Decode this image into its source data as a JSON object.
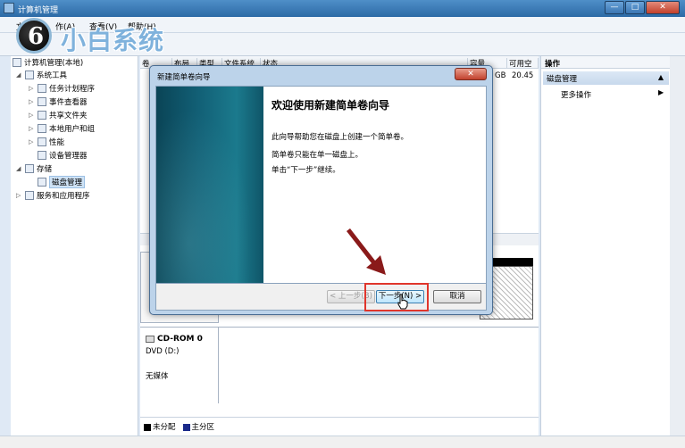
{
  "window": {
    "title": "计算机管理",
    "minimize": "—",
    "maximize": "□",
    "close": "✕"
  },
  "menu": [
    "文",
    "作(A)",
    "查看(V)",
    "帮助(H)"
  ],
  "logo": {
    "badge": "6",
    "text": "小白系统"
  },
  "tree": {
    "root": "计算机管理(本地)",
    "system_tools": "系统工具",
    "task_scheduler": "任务计划程序",
    "event_viewer": "事件查看器",
    "shared_folders": "共享文件夹",
    "local_users": "本地用户和组",
    "performance": "性能",
    "device_manager": "设备管理器",
    "storage": "存储",
    "disk_management": "磁盘管理",
    "services_apps": "服务和应用程序"
  },
  "list": {
    "columns": [
      "卷",
      "布局",
      "类型",
      "文件系统",
      "状态",
      "容量",
      "可用空"
    ],
    "row1": {
      "capacity": "GB",
      "free": "20.45"
    }
  },
  "disks": {
    "cdrom_label": "CD-ROM 0",
    "cdrom_type": "DVD (D:)",
    "cdrom_media": "无媒体"
  },
  "legend": {
    "unallocated": "未分配",
    "primary": "主分区"
  },
  "colors": {
    "unallocated": "#000000",
    "primary": "#1a2a8a",
    "highlight": "#e0352b",
    "arrow": "#8a1a1a"
  },
  "actions": {
    "header": "操作",
    "group": "磁盘管理",
    "more": "更多操作"
  },
  "wizard": {
    "title": "新建简单卷向导",
    "heading": "欢迎使用新建简单卷向导",
    "line1": "此向导帮助您在磁盘上创建一个简单卷。",
    "line2": "简单卷只能在单一磁盘上。",
    "line3": "单击“下一步”继续。",
    "back": "< 上一步(B)",
    "next": "下一步(N) >",
    "cancel": "取消"
  }
}
